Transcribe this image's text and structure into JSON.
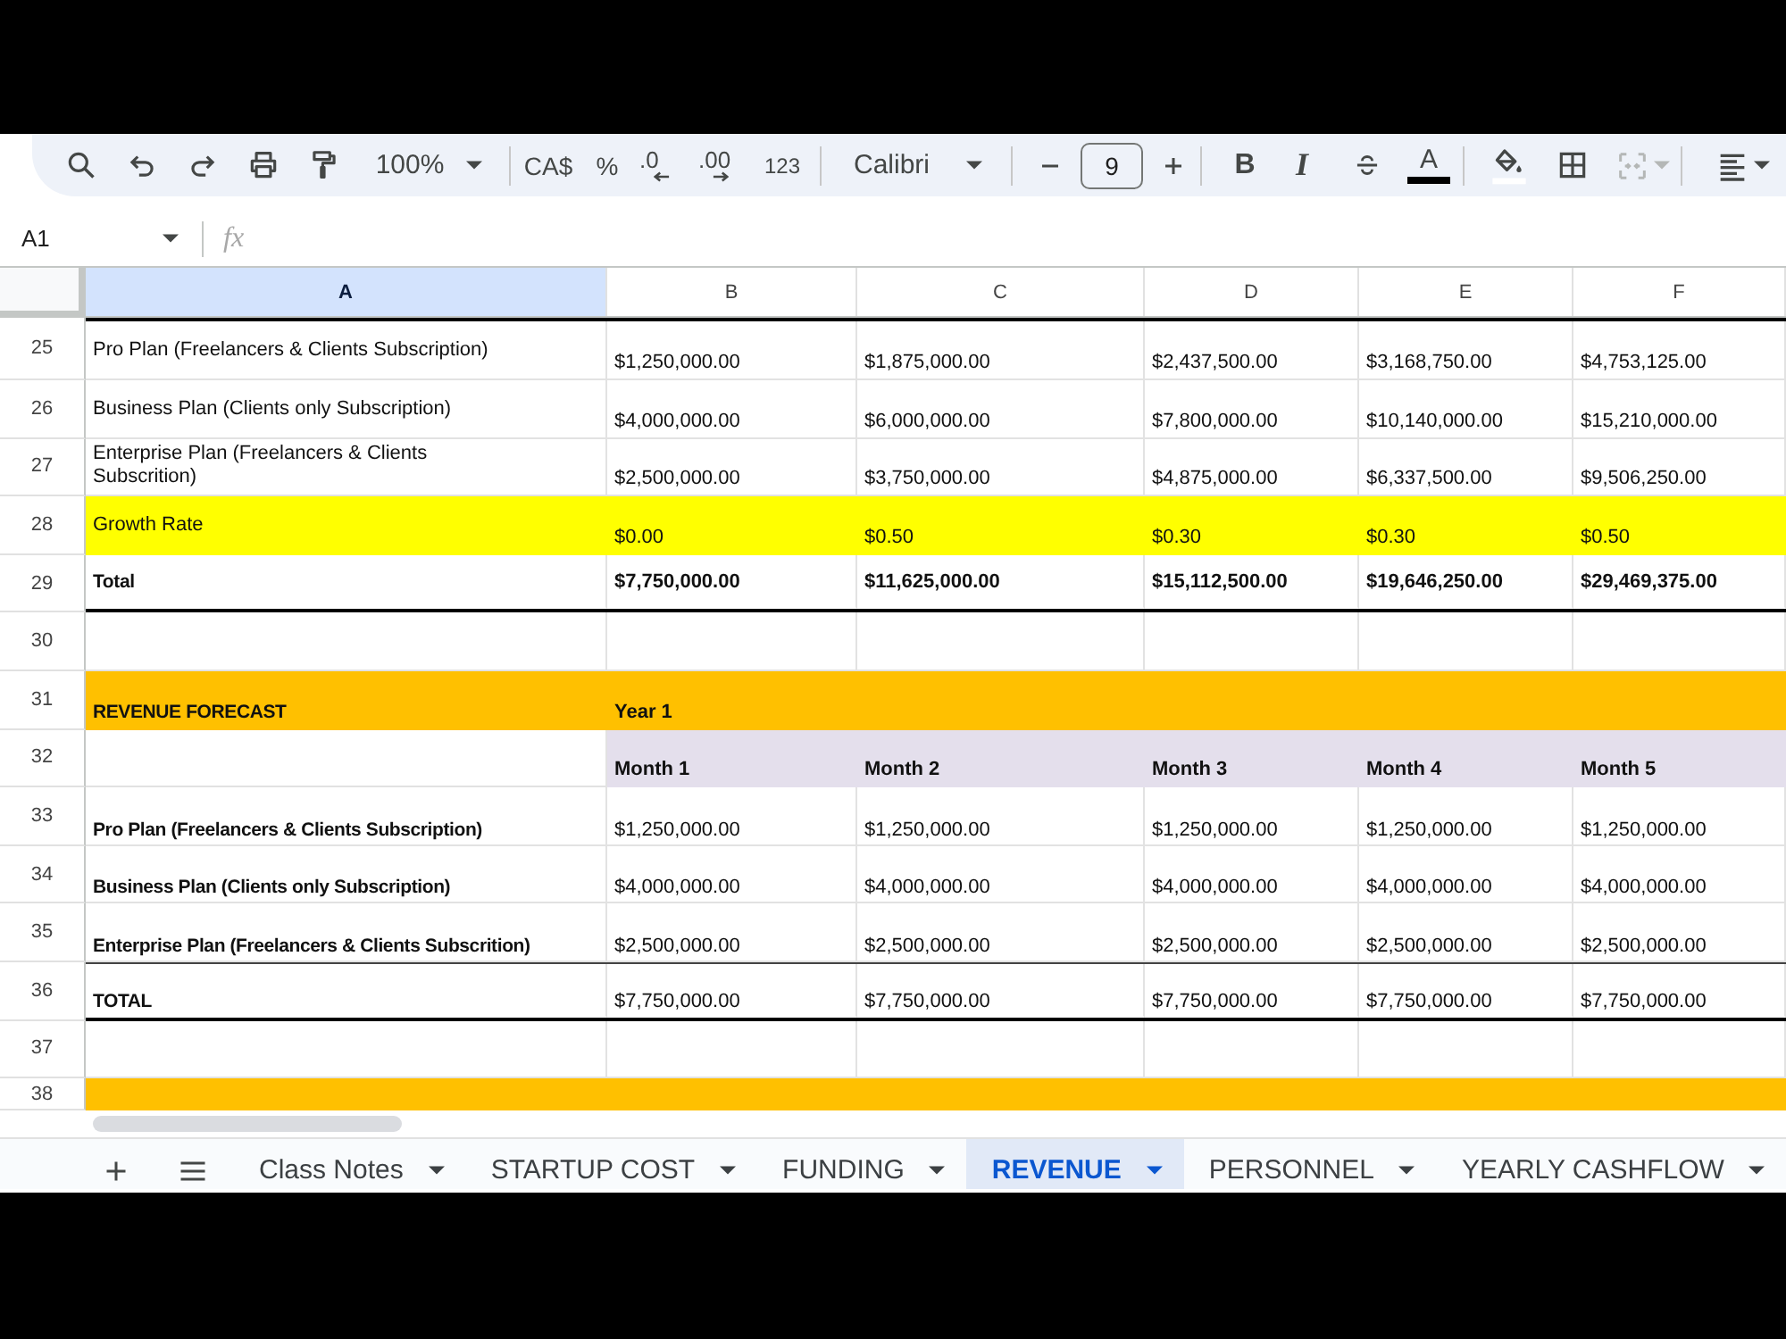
{
  "toolbar": {
    "zoom": "100%",
    "currency": "CA$",
    "percent": "%",
    "decrease_decimal": ".0",
    "increase_decimal": ".00",
    "number_format": "123",
    "font": "Calibri",
    "font_size": "9",
    "bold": "B",
    "italic": "I",
    "text_color": "A",
    "merge_disabled": true
  },
  "formula_bar": {
    "cell_ref": "A1",
    "fx": "fx"
  },
  "columns": [
    {
      "label": "A",
      "selected": true
    },
    {
      "label": "B",
      "selected": false
    },
    {
      "label": "C",
      "selected": false
    },
    {
      "label": "D",
      "selected": false
    },
    {
      "label": "E",
      "selected": false
    },
    {
      "label": "F",
      "selected": false
    }
  ],
  "rows": [
    {
      "number": "25",
      "kind": "line",
      "rule_above": true,
      "label": "Pro Plan (Freelancers & Clients Subscription)",
      "values": [
        "$1,250,000.00",
        "$1,875,000.00",
        "$2,437,500.00",
        "$3,168,750.00",
        "$4,753,125.00"
      ]
    },
    {
      "number": "26",
      "kind": "line",
      "label": "Business Plan (Clients only Subscription)",
      "values": [
        "$4,000,000.00",
        "$6,000,000.00",
        "$7,800,000.00",
        "$10,140,000.00",
        "$15,210,000.00"
      ]
    },
    {
      "number": "27",
      "kind": "line",
      "wrap": true,
      "label": "Enterprise Plan (Freelancers & Clients Subscrition)",
      "values": [
        "$2,500,000.00",
        "$3,750,000.00",
        "$4,875,000.00",
        "$6,337,500.00",
        "$9,506,250.00"
      ]
    },
    {
      "number": "28",
      "kind": "highlight",
      "label": "Growth Rate",
      "values": [
        "$0.00",
        "$0.50",
        "$0.30",
        "$0.30",
        "$0.50"
      ]
    },
    {
      "number": "29",
      "kind": "total",
      "label": "Total",
      "values": [
        "$7,750,000.00",
        "$11,625,000.00",
        "$15,112,500.00",
        "$19,646,250.00",
        "$29,469,375.00"
      ]
    },
    {
      "number": "30",
      "kind": "blank"
    },
    {
      "number": "31",
      "kind": "section",
      "label": "REVENUE FORECAST",
      "values": [
        "Year 1"
      ]
    },
    {
      "number": "32",
      "kind": "subheader",
      "values": [
        "Month 1",
        "Month 2",
        "Month 3",
        "Month 4",
        "Month 5"
      ]
    },
    {
      "number": "33",
      "kind": "item",
      "label": "Pro Plan (Freelancers & Clients Subscription)",
      "values": [
        "$1,250,000.00",
        "$1,250,000.00",
        "$1,250,000.00",
        "$1,250,000.00",
        "$1,250,000.00"
      ]
    },
    {
      "number": "34",
      "kind": "item",
      "label": "Business Plan (Clients only Subscription)",
      "values": [
        "$4,000,000.00",
        "$4,000,000.00",
        "$4,000,000.00",
        "$4,000,000.00",
        "$4,000,000.00"
      ]
    },
    {
      "number": "35",
      "kind": "item",
      "label": "Enterprise Plan (Freelancers & Clients Subscrition)",
      "values": [
        "$2,500,000.00",
        "$2,500,000.00",
        "$2,500,000.00",
        "$2,500,000.00",
        "$2,500,000.00"
      ]
    },
    {
      "number": "36",
      "kind": "grandtotal",
      "label": "TOTAL",
      "values": [
        "$7,750,000.00",
        "$7,750,000.00",
        "$7,750,000.00",
        "$7,750,000.00",
        "$7,750,000.00"
      ]
    },
    {
      "number": "37",
      "kind": "blank"
    },
    {
      "number": "38",
      "kind": "band"
    }
  ],
  "sheet_tabs": [
    {
      "label": "Class Notes",
      "selected": false
    },
    {
      "label": "STARTUP COST",
      "selected": false
    },
    {
      "label": "FUNDING",
      "selected": false
    },
    {
      "label": "REVENUE",
      "selected": true
    },
    {
      "label": "PERSONNEL",
      "selected": false
    },
    {
      "label": "YEARLY CASHFLOW",
      "selected": false
    }
  ]
}
